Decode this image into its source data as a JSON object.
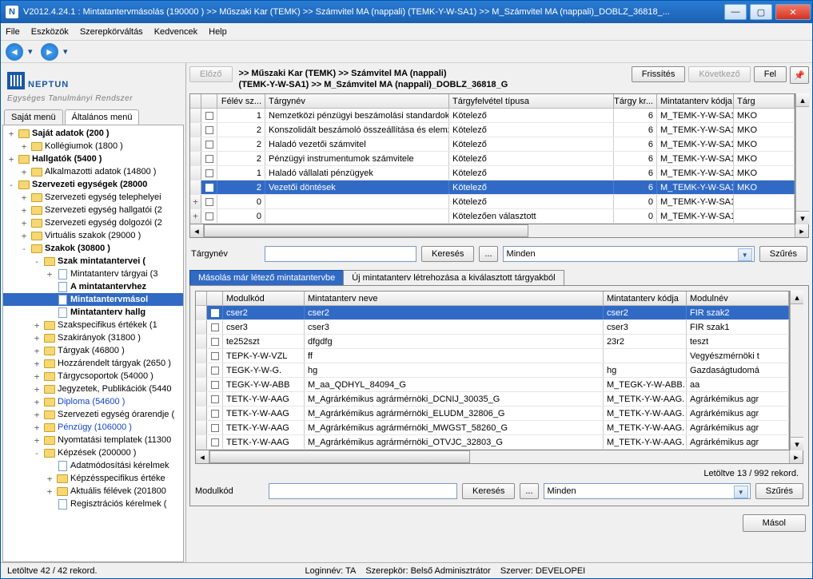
{
  "window": {
    "title": "V2012.4.24.1 : Mintatantervmásolás (190000  )  >> Műszaki Kar (TEMK) >> Számvitel MA (nappali) (TEMK-Y-W-SA1) >> M_Számvitel MA (nappali)_DOBLZ_36818_..."
  },
  "menu": {
    "items": [
      "File",
      "Eszközök",
      "Szerepkörváltás",
      "Kedvencek",
      "Help"
    ]
  },
  "logo": {
    "brand": "NEPTUN",
    "sub": "Egységes Tanulmányi Rendszer"
  },
  "left_tabs": {
    "t1": "Saját menü",
    "t2": "Általános menü"
  },
  "tree": [
    {
      "d": 0,
      "e": "+",
      "i": "fold",
      "b": 1,
      "t": "Saját adatok (200  )"
    },
    {
      "d": 1,
      "e": "+",
      "i": "fold",
      "t": "Kollégiumok (1800  )"
    },
    {
      "d": 0,
      "e": "+",
      "i": "fold",
      "b": 1,
      "t": "Hallgatók (5400  )"
    },
    {
      "d": 1,
      "e": "+",
      "i": "fold",
      "t": "Alkalmazotti adatok (14800  )"
    },
    {
      "d": 0,
      "e": "-",
      "i": "fold",
      "b": 1,
      "t": "Szervezeti egységek (28000"
    },
    {
      "d": 1,
      "e": "+",
      "i": "fold",
      "t": "Szervezeti egység telephelyei"
    },
    {
      "d": 1,
      "e": "+",
      "i": "fold",
      "t": "Szervezeti egység hallgatói (2"
    },
    {
      "d": 1,
      "e": "+",
      "i": "fold",
      "t": "Szervezeti egység dolgozói (2"
    },
    {
      "d": 1,
      "e": "+",
      "i": "fold",
      "t": "Virtuális szakok (29000  )"
    },
    {
      "d": 1,
      "e": "-",
      "i": "fold",
      "b": 1,
      "t": "Szakok (30800  )"
    },
    {
      "d": 2,
      "e": "-",
      "i": "fold",
      "b": 1,
      "t": "Szak mintatantervei ("
    },
    {
      "d": 3,
      "e": "+",
      "i": "doc",
      "t": "Mintatanterv tárgyai (3"
    },
    {
      "d": 3,
      "e": "",
      "i": "doc",
      "b": 1,
      "t": "A mintatantervhez"
    },
    {
      "d": 3,
      "e": "",
      "i": "doc",
      "sel": 1,
      "b": 1,
      "t": "Mintatantervmásol"
    },
    {
      "d": 3,
      "e": "",
      "i": "doc",
      "b": 1,
      "t": "Mintatanterv hallg"
    },
    {
      "d": 2,
      "e": "+",
      "i": "fold",
      "t": "Szakspecifikus értékek (1"
    },
    {
      "d": 2,
      "e": "+",
      "i": "fold",
      "t": "Szakirányok (31800  )"
    },
    {
      "d": 2,
      "e": "+",
      "i": "fold",
      "t": "Tárgyak (46800  )"
    },
    {
      "d": 2,
      "e": "+",
      "i": "fold",
      "t": "Hozzárendelt tárgyak (2650  )"
    },
    {
      "d": 2,
      "e": "+",
      "i": "fold",
      "t": "Tárgycsoportok (54000  )"
    },
    {
      "d": 2,
      "e": "+",
      "i": "fold",
      "t": "Jegyzetek, Publikációk (5440"
    },
    {
      "d": 2,
      "e": "+",
      "i": "fold",
      "bl": 1,
      "t": "Diploma (54600  )"
    },
    {
      "d": 2,
      "e": "+",
      "i": "fold",
      "t": "Szervezeti egység órarendje ("
    },
    {
      "d": 2,
      "e": "+",
      "i": "fold",
      "bl": 1,
      "t": "Pénzügy (106000  )"
    },
    {
      "d": 2,
      "e": "+",
      "i": "fold",
      "t": "Nyomtatási templatek (11300"
    },
    {
      "d": 2,
      "e": "-",
      "i": "fold",
      "t": "Képzések (200000  )"
    },
    {
      "d": 3,
      "e": "",
      "i": "doc",
      "t": "Adatmódosítási kérelmek"
    },
    {
      "d": 3,
      "e": "+",
      "i": "fold",
      "t": "Képzésspecifikus értéke"
    },
    {
      "d": 3,
      "e": "+",
      "i": "fold",
      "t": "Aktuális félévek (201800"
    },
    {
      "d": 3,
      "e": "",
      "i": "doc",
      "t": "Regisztrációs kérelmek ("
    }
  ],
  "top": {
    "prev": "Előző",
    "crumb1": ">> Műszaki Kar (TEMK) >> Számvitel MA (nappali)",
    "crumb2": "(TEMK-Y-W-SA1) >> M_Számvitel MA (nappali)_DOBLZ_36818_G",
    "refresh": "Frissítés",
    "next": "Következő",
    "up": "Fel"
  },
  "grid1": {
    "cols": [
      "",
      "",
      "Félév sz...",
      "Tárgynév",
      "Tárgyfelvétel típusa",
      "Tárgy kr...",
      "Mintatanterv kódja",
      "Tárg"
    ],
    "rows": [
      {
        "f": "1",
        "n": "Nemzetközi pénzügyi beszámolási standardok",
        "t": "Kötelező",
        "k": "6",
        "m": "M_TEMK-Y-W-SA1.",
        "x": "MKO"
      },
      {
        "f": "2",
        "n": "Konszolidált beszámoló összeállítása és elemzése",
        "t": "Kötelező",
        "k": "6",
        "m": "M_TEMK-Y-W-SA1.",
        "x": "MKO"
      },
      {
        "f": "2",
        "n": "Haladó vezetői számvitel",
        "t": "Kötelező",
        "k": "6",
        "m": "M_TEMK-Y-W-SA1.",
        "x": "MKO"
      },
      {
        "f": "2",
        "n": "Pénzügyi instrumentumok számvitele",
        "t": "Kötelező",
        "k": "6",
        "m": "M_TEMK-Y-W-SA1.",
        "x": "MKO"
      },
      {
        "f": "1",
        "n": "Haladó vállalati pénzügyek",
        "t": "Kötelező",
        "k": "6",
        "m": "M_TEMK-Y-W-SA1.",
        "x": "MKO"
      },
      {
        "f": "2",
        "n": "Vezetői döntések",
        "t": "Kötelező",
        "k": "6",
        "m": "M_TEMK-Y-W-SA1.",
        "x": "MKO",
        "sel": 1
      },
      {
        "rh": "+",
        "f": "0",
        "n": "",
        "t": "Kötelező",
        "k": "0",
        "m": "M_TEMK-Y-W-SA1.",
        "x": ""
      },
      {
        "rh": "+",
        "f": "0",
        "n": "",
        "t": "Kötelezően választott",
        "k": "0",
        "m": "M_TEMK-Y-W-SA1.",
        "x": ""
      }
    ]
  },
  "search1": {
    "label": "Tárgynév",
    "btn": "Keresés",
    "dots": "...",
    "combo": "Minden",
    "filter": "Szűrés"
  },
  "tabs2": {
    "a": "Másolás már létező mintatantervbe",
    "b": "Új mintatanterv létrehozása a kiválasztott tárgyakból"
  },
  "grid2": {
    "cols": [
      "",
      "",
      "Modulkód",
      "Mintatanterv neve",
      "Mintatanterv kódja",
      "Modulnév"
    ],
    "rows": [
      {
        "m": "cser2",
        "n": "cser2",
        "k": "cser2",
        "mn": "FIR szak2",
        "sel": 1
      },
      {
        "m": "cser3",
        "n": "cser3",
        "k": "cser3",
        "mn": "FIR szak1"
      },
      {
        "m": "te252szt",
        "n": "dfgdfg",
        "k": "23r2",
        "mn": "teszt"
      },
      {
        "m": "TEPK-Y-W-VZL",
        "n": "ff",
        "k": "",
        "mn": "Vegyészmérnöki t"
      },
      {
        "m": "TEGK-Y-W-G.",
        "n": "hg",
        "k": "hg",
        "mn": "Gazdaságtudomá"
      },
      {
        "m": "TEGK-Y-W-ABB",
        "n": "M_aa_QDHYL_84094_G",
        "k": "M_TEGK-Y-W-ABB.",
        "mn": "aa"
      },
      {
        "m": "TETK-Y-W-AAG",
        "n": "M_Agrárkémikus agrármérnöki_DCNIJ_30035_G",
        "k": "M_TETK-Y-W-AAG.",
        "mn": "Agrárkémikus agr"
      },
      {
        "m": "TETK-Y-W-AAG",
        "n": "M_Agrárkémikus agrármérnöki_ELUDM_32806_G",
        "k": "M_TETK-Y-W-AAG.",
        "mn": "Agrárkémikus agr"
      },
      {
        "m": "TETK-Y-W-AAG",
        "n": "M_Agrárkémikus agrármérnöki_MWGST_58260_G",
        "k": "M_TETK-Y-W-AAG.",
        "mn": "Agrárkémikus agr"
      },
      {
        "m": "TETK-Y-W-AAG",
        "n": "M_Agrárkémikus agrármérnöki_OTVJC_32803_G",
        "k": "M_TETK-Y-W-AAG.",
        "mn": "Agrárkémikus agr"
      }
    ],
    "recordline": "Letöltve 13 / 992 rekord."
  },
  "search2": {
    "label": "Modulkód",
    "btn": "Keresés",
    "dots": "...",
    "combo": "Minden",
    "filter": "Szűrés"
  },
  "copybtn": "Másol",
  "status": {
    "left": "Letöltve 42 / 42 rekord.",
    "login": "Loginnév: TA",
    "role": "Szerepkör: Belső Adminisztrátor",
    "server": "Szerver: DEVELOPEI"
  }
}
